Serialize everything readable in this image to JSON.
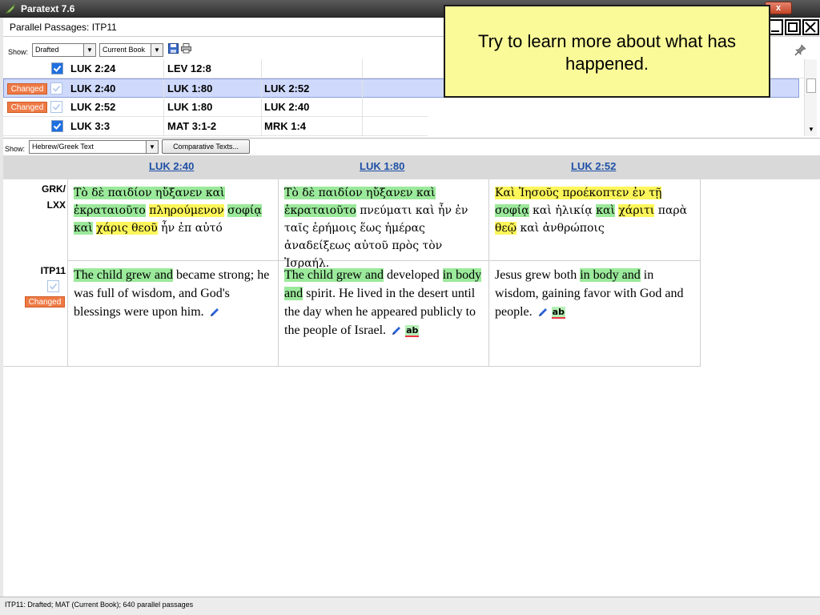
{
  "app": {
    "title": "Paratext 7.6",
    "close_label": "x"
  },
  "window": {
    "title": "Parallel Passages: ITP11"
  },
  "toolbar1": {
    "show_label": "Show:",
    "filter_value": "Drafted",
    "scope_value": "Current Book"
  },
  "passages": [
    {
      "status": "",
      "checked": true,
      "refs": [
        "LUK 2:24",
        "LEV 12:8",
        ""
      ]
    },
    {
      "status": "Changed",
      "checked": false,
      "refs": [
        "LUK 2:40",
        "LUK 1:80",
        "LUK 2:52"
      ]
    },
    {
      "status": "Changed",
      "checked": false,
      "refs": [
        "LUK 2:52",
        "LUK 1:80",
        "LUK 2:40"
      ]
    },
    {
      "status": "",
      "checked": true,
      "refs": [
        "LUK 3:3",
        "MAT 3:1-2",
        "MRK 1:4"
      ]
    }
  ],
  "toolbar2": {
    "show_label": "Show:",
    "text_value": "Hebrew/Greek Text",
    "comparative_button": "Comparative Texts..."
  },
  "compare": {
    "columns": [
      "LUK 2:40",
      "LUK 1:80",
      "LUK 2:52"
    ],
    "row1_label": "GRK/\nLXX",
    "row2_label": "ITP11",
    "row2_status": "Changed",
    "greek": [
      [
        [
          "Τὸ δὲ παιδίον ηὔξανεν καὶ",
          "g"
        ],
        [
          " ",
          ""
        ],
        [
          "ἐκραταιοῦτο",
          "g"
        ],
        [
          " ",
          ""
        ],
        [
          "πληρούμενον",
          "y"
        ],
        [
          " ",
          ""
        ],
        [
          "σοφίᾳ",
          "g"
        ],
        [
          " ",
          ""
        ],
        [
          "καὶ",
          "g"
        ],
        [
          " ",
          ""
        ],
        [
          "χάρις θεοῦ",
          "y"
        ],
        [
          " ἦν ἐπ αὐτό",
          ""
        ]
      ],
      [
        [
          "Τὸ δὲ παιδίον ηὔξανεν καὶ",
          "g"
        ],
        [
          " ",
          ""
        ],
        [
          "ἐκραταιοῦτο",
          "g"
        ],
        [
          " πνεύματι καὶ ἦν ἐν ταῖς ἐρήμοις ἕως ἡμέρας ἀναδείξεως αὐτοῦ πρὸς τὸν Ἰσραήλ.",
          ""
        ]
      ],
      [
        [
          "Καὶ Ἰησοῦς προέκοπτεν ἐν τῇ",
          "y"
        ],
        [
          " ",
          ""
        ],
        [
          "σοφίᾳ",
          "g"
        ],
        [
          " καὶ ἡλικίᾳ ",
          ""
        ],
        [
          "καὶ",
          "g"
        ],
        [
          " ",
          ""
        ],
        [
          "χάριτι",
          "y"
        ],
        [
          " παρὰ ",
          ""
        ],
        [
          "θεῷ",
          "y"
        ],
        [
          " καὶ ἀνθρώποις",
          ""
        ]
      ]
    ],
    "english": [
      [
        [
          "The child grew and",
          "g"
        ],
        [
          " became strong; he was full of wisdom, and God's blessings were upon him.",
          ""
        ]
      ],
      [
        [
          "The child grew and",
          "g"
        ],
        [
          " developed ",
          ""
        ],
        [
          "in body and",
          "g"
        ],
        [
          " spirit. He lived in the desert until the day when he appeared publicly to the people of Israel.",
          ""
        ]
      ],
      [
        [
          "Jesus grew both ",
          ""
        ],
        [
          "in body and",
          "g"
        ],
        [
          " in wisdom, gaining favor with God and people.",
          ""
        ]
      ]
    ],
    "spell_label": "ab"
  },
  "note": {
    "text": "Try to learn more about what has happened."
  },
  "statusbar": {
    "text": "ITP11: Drafted; MAT (Current Book); 640 parallel passages"
  },
  "colors": {
    "highlight_green": "#9be99b",
    "highlight_yellow": "#fdf65a",
    "changed_badge": "#ee7a45",
    "link": "#1f4fa6",
    "note_bg": "#fafa99"
  },
  "icons": [
    "app-leaf-icon",
    "save-icon",
    "print-icon",
    "pin-icon",
    "pencil-icon",
    "checkbox-checked-icon",
    "minimize-icon",
    "maximize-icon",
    "close-icon"
  ]
}
